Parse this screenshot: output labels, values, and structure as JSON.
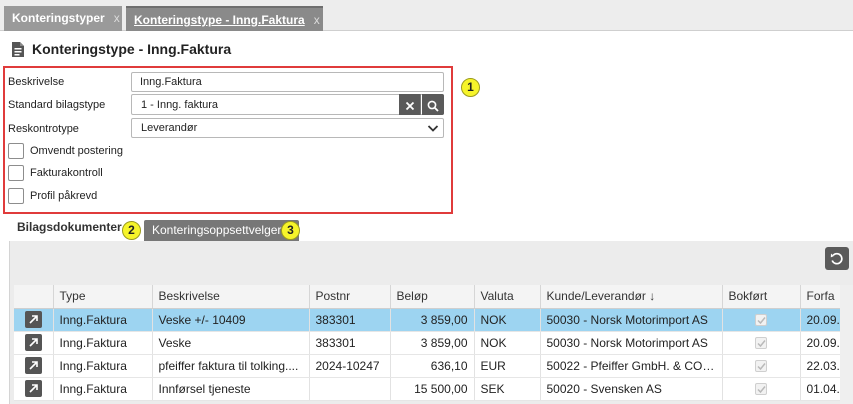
{
  "tabs": [
    {
      "label": "Konteringstyper",
      "close": "x"
    },
    {
      "label": "Konteringstype - Inng.Faktura",
      "close": "x"
    }
  ],
  "page": {
    "title": "Konteringstype - Inng.Faktura",
    "icon": "document-icon"
  },
  "form": {
    "description_label": "Beskrivelse",
    "description_value": "Inng.Faktura",
    "doc_type_label": "Standard bilagstype",
    "doc_type_value": "1 - Inng. faktura",
    "ledger_type_label": "Reskontrotype",
    "ledger_type_value": "Leverandør",
    "checkboxes": [
      {
        "label": "Omvendt postering",
        "checked": false
      },
      {
        "label": "Fakturakontroll",
        "checked": false
      },
      {
        "label": "Profil påkrevd",
        "checked": false
      }
    ]
  },
  "callouts": [
    "1",
    "2",
    "3"
  ],
  "section_tabs": {
    "documents": "Bilagsdokumenter",
    "posting_setup": "Konteringsoppsettvelger"
  },
  "grid": {
    "columns": [
      "",
      "Type",
      "Beskrivelse",
      "Postnr",
      "Beløp",
      "Valuta",
      "Kunde/Leverandør ↓",
      "Bokført",
      "Forfa"
    ],
    "rows": [
      {
        "type": "Inng.Faktura",
        "description": "Veske +/- 10409",
        "postnr": "383301",
        "amount": "3 859,00",
        "currency": "NOK",
        "party": "50030 - Norsk Motorimport AS",
        "posted": true,
        "due": "20.09.",
        "selected": true
      },
      {
        "type": "Inng.Faktura",
        "description": "Veske",
        "postnr": "383301",
        "amount": "3 859,00",
        "currency": "NOK",
        "party": "50030 - Norsk Motorimport AS",
        "posted": true,
        "due": "20.09.",
        "selected": false
      },
      {
        "type": "Inng.Faktura",
        "description": "pfeiffer faktura til tolking....",
        "postnr": "2024-10247",
        "amount": "636,10",
        "currency": "EUR",
        "party": "50022 - Pfeiffer GmbH. & CO. ...",
        "posted": true,
        "due": "22.03.",
        "selected": false
      },
      {
        "type": "Inng.Faktura",
        "description": "Innførsel tjeneste",
        "postnr": "",
        "amount": "15 500,00",
        "currency": "SEK",
        "party": "50020 - Svensken AS",
        "posted": true,
        "due": "01.04.",
        "selected": false
      }
    ]
  },
  "colors": {
    "highlight": "#e03b3b",
    "callout": "#f6f42a",
    "selected_row": "#9dd4f1",
    "button": "#5a5a5a"
  }
}
